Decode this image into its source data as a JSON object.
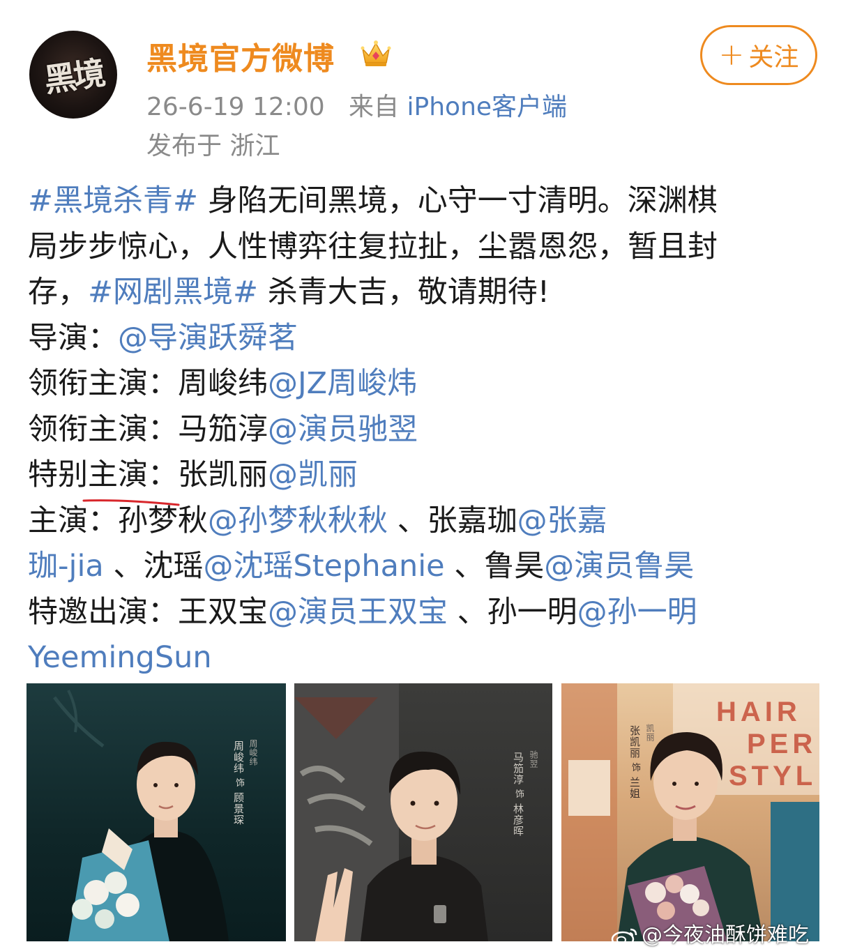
{
  "account": {
    "avatar_text": "黑境",
    "name": "黑境官方微博",
    "badge_icon": "crown-icon"
  },
  "meta": {
    "time": "26-6-19 12:00",
    "source_prefix": "来自",
    "client": "iPhone客户端",
    "location": "发布于 浙江"
  },
  "follow": {
    "icon": "plus-icon",
    "plus": "+",
    "label": "关注"
  },
  "post": {
    "l1_tag": "#黑境杀青#",
    "l1_text": " 身陷无间黑境，心守一寸清明。深渊棋",
    "l2_text": "局步步惊心，人性博弈往复拉扯，尘嚣恩怨，暂且封",
    "l3_text_a": "存，",
    "l3_tag": "#网剧黑境#",
    "l3_text_b": " 杀青大吉，敬请期待!",
    "director_label": "导演：",
    "director_mention": "@导演跃舜茗",
    "lead1_label": "领衔主演：",
    "lead1_name": "周峻纬",
    "lead1_mention": "@JZ周峻炜",
    "lead2_label": "领衔主演：",
    "lead2_name": "马笳淳",
    "lead2_mention": "@演员驰翌",
    "special_label": "特别主演：",
    "special_name": "张凯丽",
    "special_mention": "@凯丽",
    "cast_label": "主演：",
    "cast1_name": "孙梦秋",
    "cast1_mention": "@孙梦秋秋秋",
    "sep1": " 、",
    "cast2_name": "张嘉珈",
    "cast2_mention_a": "@张嘉",
    "cast2_mention_b": "珈-jia",
    "sep2": " 、",
    "cast3_name": "沈瑶",
    "cast3_mention": "@沈瑶Stephanie",
    "sep3": " 、",
    "cast4_name": "鲁昊",
    "cast4_mention": "@演员鲁昊",
    "guest_label": "特邀出演：",
    "guest1_name": "王双宝",
    "guest1_mention": "@演员王双宝",
    "sep4": " 、",
    "guest2_name": "孙一明",
    "guest2_mention_a": "@孙一明",
    "guest2_mention_b": "YeemingSun"
  },
  "photos": [
    {
      "actor": "周峻纬",
      "role": "顾景琛",
      "note": "周峻纬",
      "sign": "饰"
    },
    {
      "actor": "马笳淳",
      "role": "林彦晖",
      "note": "驰翌",
      "sign": "饰"
    },
    {
      "actor": "张凯丽",
      "role": "兰姐",
      "note": "凯丽",
      "sign": "饰"
    }
  ],
  "photo3_sign": "HAIR PER STYL",
  "photo3_sign_lines": [
    "HAIR",
    "PER",
    "STYL"
  ],
  "watermark": {
    "icon": "weibo-icon",
    "text": "@今夜油酥饼难吃"
  },
  "colors": {
    "brand_orange": "#ee8a1f",
    "link_blue": "#4f7dbd",
    "meta_gray": "#8a8a8a",
    "text": "#1a1a1a"
  }
}
